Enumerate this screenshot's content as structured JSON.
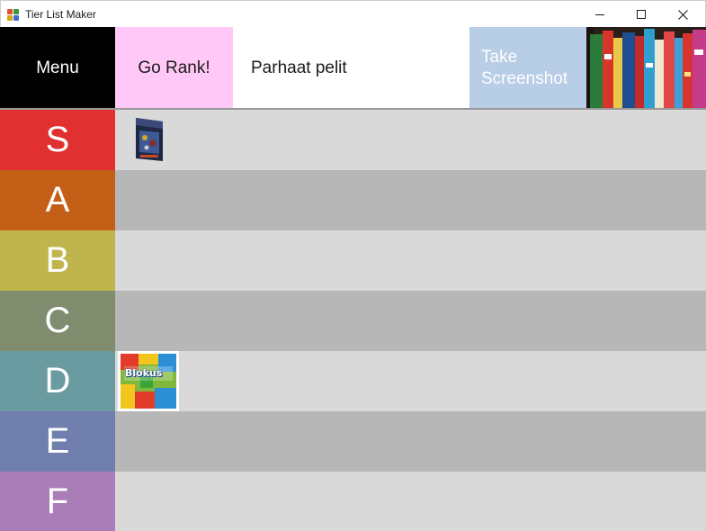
{
  "window": {
    "title": "Tier List Maker",
    "controls": [
      "minimize",
      "maximize",
      "close"
    ]
  },
  "toolbar": {
    "menu_label": "Menu",
    "rank_label": "Go Rank!",
    "list_title": "Parhaat pelit",
    "screenshot_line1": "Take",
    "screenshot_line2": "Screenshot",
    "colors": {
      "menu_bg": "#000000",
      "rank_bg": "#ffc8f6",
      "screenshot_bg": "#b8cde6"
    }
  },
  "tiers": [
    {
      "label": "S",
      "color": "#e0302f",
      "items": [
        {
          "name": "board-game-box-dark",
          "title": ""
        }
      ]
    },
    {
      "label": "A",
      "color": "#c45f18",
      "items": []
    },
    {
      "label": "B",
      "color": "#c0b54d",
      "items": []
    },
    {
      "label": "C",
      "color": "#7f8c6d",
      "items": []
    },
    {
      "label": "D",
      "color": "#6a9ba0",
      "items": [
        {
          "name": "blokus-box",
          "title": "Blokus"
        }
      ]
    },
    {
      "label": "E",
      "color": "#707fad",
      "items": []
    },
    {
      "label": "F",
      "color": "#aa7cb8",
      "items": []
    }
  ]
}
